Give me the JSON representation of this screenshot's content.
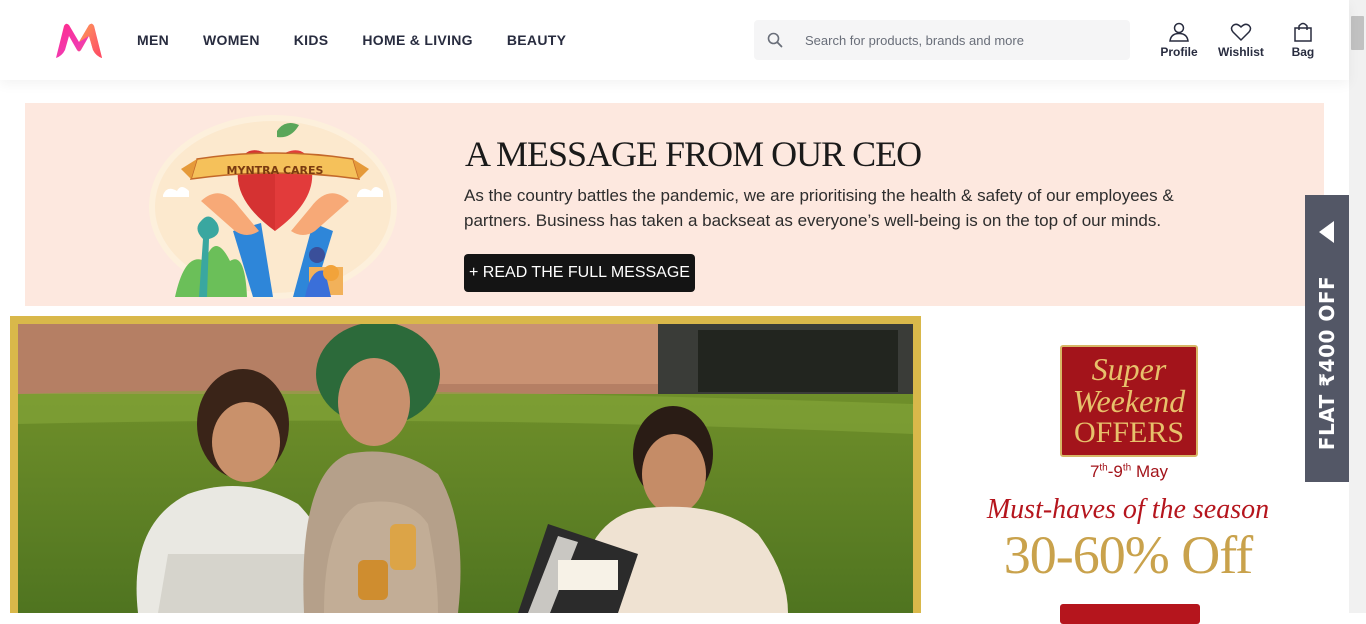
{
  "brand": {
    "logo_icon": "myntra-logo-icon"
  },
  "nav": [
    "MEN",
    "WOMEN",
    "KIDS",
    "HOME & LIVING",
    "BEAUTY"
  ],
  "search": {
    "placeholder": "Search for products, brands and more",
    "icon": "search-icon"
  },
  "actions": {
    "profile": "Profile",
    "wishlist": "Wishlist",
    "bag": "Bag"
  },
  "ceo_banner": {
    "badge": "MYNTRA CARES",
    "title": "A MESSAGE FROM OUR CEO",
    "text": "As the country battles the pandemic, we are prioritising the health & safety of our employees & partners. Business has taken a backseat as everyone’s well-being is on the top of our minds.",
    "button": "+ READ THE FULL MESSAGE",
    "bg_color": "#fde8df"
  },
  "offer": {
    "line1": "Super",
    "line2": "Weekend",
    "line3": "OFFERS",
    "date_a": "7",
    "date_a_sup": "th",
    "date_sep": "-9",
    "date_b_sup": "th",
    "date_month": " May",
    "tagline": "Must-haves of the season",
    "discount": "30-60% Off"
  },
  "side_tab": {
    "label": "FLAT ₹400 OFF",
    "icon": "arrow-left-icon"
  },
  "colors": {
    "brand_pink": "#ff3f6c",
    "offer_red": "#a3141b",
    "gold": "#c9a24c",
    "nav_text": "#282c3f"
  }
}
